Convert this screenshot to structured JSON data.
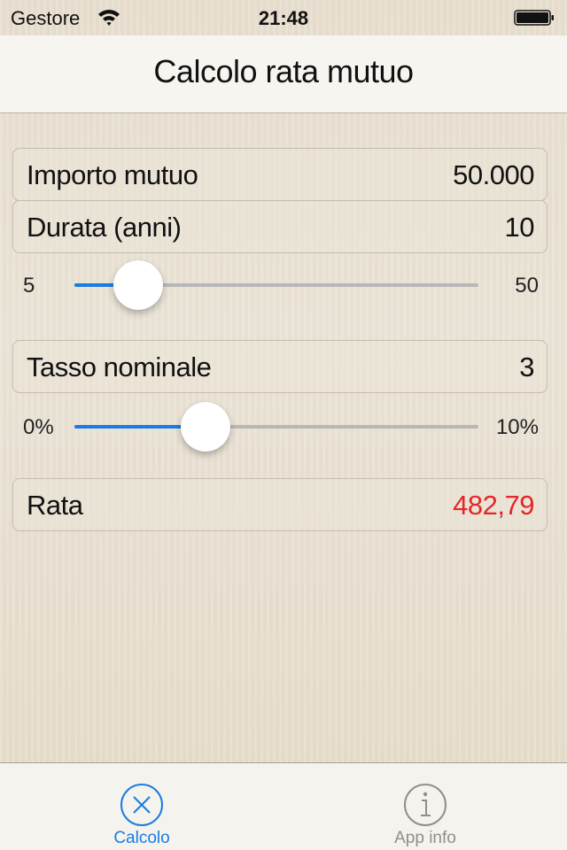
{
  "status_bar": {
    "carrier": "Gestore",
    "time": "21:48",
    "wifi_icon": "wifi-icon",
    "battery_icon": "battery-icon"
  },
  "nav": {
    "title": "Calcolo rata mutuo"
  },
  "form": {
    "loan_amount": {
      "label": "Importo mutuo",
      "value": "50.000"
    },
    "duration": {
      "label": "Durata (anni)",
      "value": "10"
    },
    "duration_slider": {
      "min_label": "5",
      "max_label": "50",
      "min": 5,
      "max": 50,
      "value": 10
    },
    "rate": {
      "label": "Tasso nominale",
      "value": "3"
    },
    "rate_slider": {
      "min_label": "0%",
      "max_label": "10%",
      "min": 0,
      "max": 10,
      "value": 3
    },
    "installment": {
      "label": "Rata",
      "value": "482,79"
    }
  },
  "colors": {
    "accent": "#1a7ce0",
    "result": "#e5262a",
    "inactive": "#8e8e8e"
  },
  "tabs": [
    {
      "label": "Calcolo",
      "icon": "close-circle-icon",
      "active": true
    },
    {
      "label": "App info",
      "icon": "info-circle-icon",
      "active": false
    }
  ]
}
